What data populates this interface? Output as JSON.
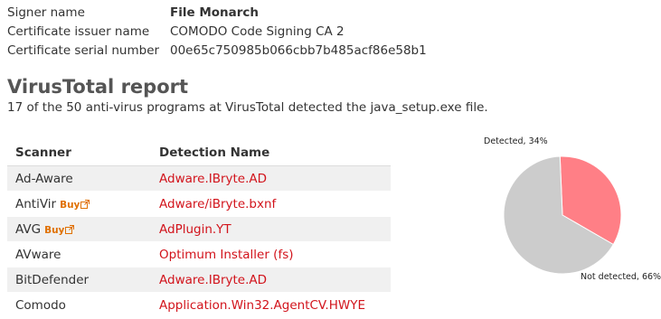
{
  "cert": {
    "rows": [
      {
        "label": "Signer name",
        "value": "File Monarch"
      },
      {
        "label": "Certificate issuer name",
        "value": "COMODO Code Signing CA 2"
      },
      {
        "label": "Certificate serial number",
        "value": "00e65c750985b066cbb7b485acf86e58b1"
      }
    ]
  },
  "report": {
    "title": "VirusTotal report",
    "summary": "17 of the 50 anti-virus programs at VirusTotal detected the java_setup.exe file."
  },
  "table": {
    "headers": {
      "scanner": "Scanner",
      "detection": "Detection Name"
    },
    "buy_label": "Buy",
    "rows": [
      {
        "scanner": "Ad-Aware",
        "detection": "Adware.IBryte.AD",
        "buy": false
      },
      {
        "scanner": "AntiVir",
        "detection": "Adware/iBryte.bxnf",
        "buy": true
      },
      {
        "scanner": "AVG",
        "detection": "AdPlugin.YT",
        "buy": true
      },
      {
        "scanner": "AVware",
        "detection": "Optimum Installer (fs)",
        "buy": false
      },
      {
        "scanner": "BitDefender",
        "detection": "Adware.IBryte.AD",
        "buy": false
      },
      {
        "scanner": "Comodo",
        "detection": "Application.Win32.AgentCV.HWYE",
        "buy": false
      }
    ]
  },
  "chart_data": {
    "type": "pie",
    "slices": [
      {
        "label": "Detected, 34%",
        "value": 34,
        "color": "#ff7f86"
      },
      {
        "label": "Not detected, 66%",
        "value": 66,
        "color": "#cccccc"
      }
    ]
  },
  "colors": {
    "detection_text": "#d2141c",
    "buy_badge": "#e07000",
    "row_alt": "#f0f0f0"
  },
  "icons": {
    "external_link": "external-link-icon"
  }
}
